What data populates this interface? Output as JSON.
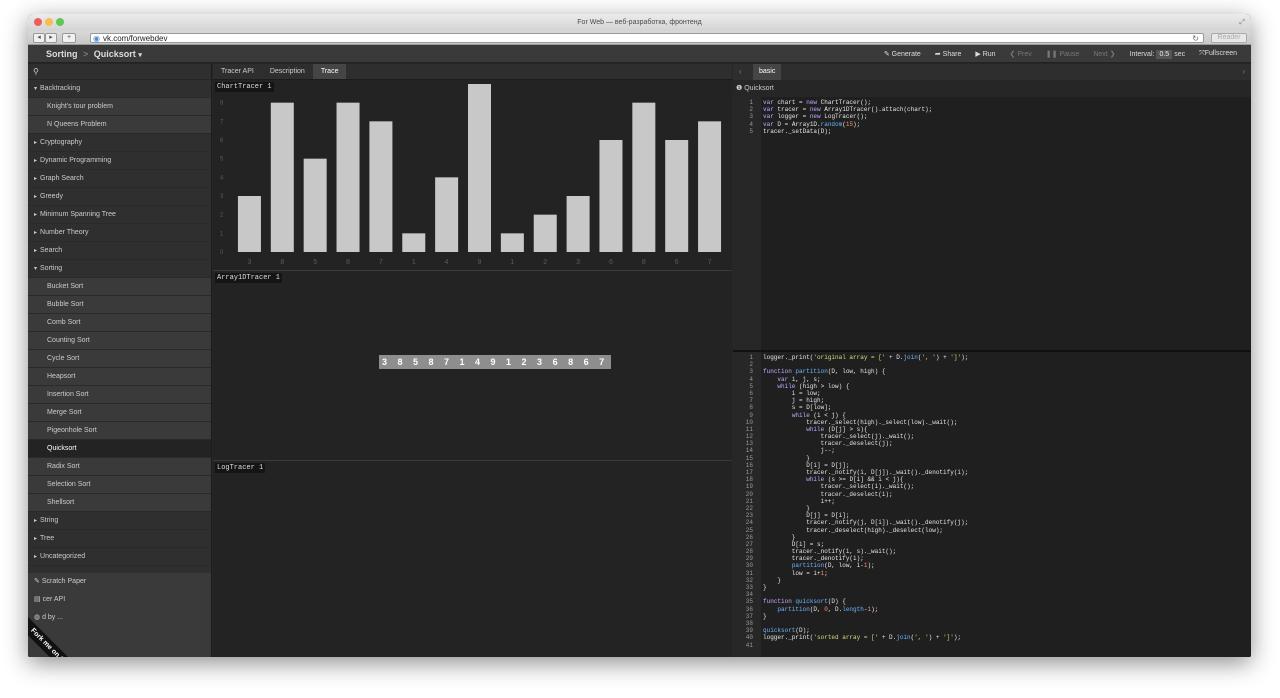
{
  "window": {
    "title": "For Web — веб-разработка, фронтенд",
    "url": "vk.com/forwebdev",
    "reader_label": "Reader"
  },
  "colors": {
    "chart_bar": "#c8c8c8",
    "code_keyword": "#c4a8ff",
    "code_func": "#6fb4ff",
    "code_string": "#dcdc7c",
    "code_number": "#ff8c62"
  },
  "app": {
    "breadcrumb": {
      "category": "Sorting",
      "separator": ">",
      "current": "Quicksort"
    },
    "toolbar": {
      "generate": "Generate",
      "share": "Share",
      "run": "Run",
      "prev": "Prev",
      "pause": "Pause",
      "next": "Next",
      "interval_label": "Interval:",
      "interval_value": "0.5",
      "interval_unit": "sec",
      "fullscreen": "Fullscreen"
    }
  },
  "sidebar": {
    "items": [
      {
        "label": "Backtracking",
        "type": "category",
        "expanded": true
      },
      {
        "label": "Knight's tour problem",
        "type": "algorithm"
      },
      {
        "label": "N Queens Problem",
        "type": "algorithm"
      },
      {
        "label": "Cryptography",
        "type": "category"
      },
      {
        "label": "Dynamic Programming",
        "type": "category"
      },
      {
        "label": "Graph Search",
        "type": "category"
      },
      {
        "label": "Greedy",
        "type": "category"
      },
      {
        "label": "Minimum Spanning Tree",
        "type": "category"
      },
      {
        "label": "Number Theory",
        "type": "category"
      },
      {
        "label": "Search",
        "type": "category"
      },
      {
        "label": "Sorting",
        "type": "category",
        "expanded": true
      },
      {
        "label": "Bucket Sort",
        "type": "algorithm"
      },
      {
        "label": "Bubble Sort",
        "type": "algorithm"
      },
      {
        "label": "Comb Sort",
        "type": "algorithm"
      },
      {
        "label": "Counting Sort",
        "type": "algorithm"
      },
      {
        "label": "Cycle Sort",
        "type": "algorithm"
      },
      {
        "label": "Heapsort",
        "type": "algorithm"
      },
      {
        "label": "Insertion Sort",
        "type": "algorithm"
      },
      {
        "label": "Merge Sort",
        "type": "algorithm"
      },
      {
        "label": "Pigeonhole Sort",
        "type": "algorithm"
      },
      {
        "label": "Quicksort",
        "type": "algorithm",
        "active": true
      },
      {
        "label": "Radix Sort",
        "type": "algorithm"
      },
      {
        "label": "Selection Sort",
        "type": "algorithm"
      },
      {
        "label": "Shellsort",
        "type": "algorithm"
      },
      {
        "label": "String",
        "type": "category"
      },
      {
        "label": "Tree",
        "type": "category"
      },
      {
        "label": "Uncategorized",
        "type": "category"
      }
    ],
    "bottom_links": [
      "Scratch Paper",
      "cer API",
      "d by ..."
    ],
    "ribbon": "Fork me on GitHub"
  },
  "viz": {
    "tabs": [
      "Tracer API",
      "Description",
      "Trace"
    ],
    "active_tab": "Trace",
    "chart_label": "ChartTracer 1",
    "array_label": "Array1DTracer 1",
    "log_label": "LogTracer 1",
    "array_text": "3 8 5 8 7 1 4 9 1 2 3 6 8 6 7"
  },
  "chart_data": {
    "type": "bar",
    "categories": [
      "3",
      "8",
      "5",
      "8",
      "7",
      "1",
      "4",
      "9",
      "1",
      "2",
      "3",
      "6",
      "8",
      "6",
      "7"
    ],
    "values": [
      3,
      8,
      5,
      8,
      7,
      1,
      4,
      9,
      1,
      2,
      3,
      6,
      8,
      6,
      7
    ],
    "yticks": [
      0,
      1,
      2,
      3,
      4,
      5,
      6,
      7,
      8
    ],
    "ylim": [
      0,
      9
    ],
    "grid": false
  },
  "editor": {
    "tab": "basic",
    "file": "Quicksort",
    "data_code": [
      "var chart = new ChartTracer();",
      "var tracer = new Array1DTracer().attach(chart);",
      "var logger = new LogTracer();",
      "var D = Array1D.random(15);",
      "tracer._setData(D);"
    ],
    "algo_code": [
      "logger._print('original array = [' + D.join(', ') + ']');",
      "",
      "function partition(D, low, high) {",
      "    var i, j, s;",
      "    while (high > low) {",
      "        i = low;",
      "        j = high;",
      "        s = D[low];",
      "        while (i < j) {",
      "            tracer._select(high)._select(low)._wait();",
      "            while (D[j] > s){",
      "                tracer._select(j)._wait();",
      "                tracer._deselect(j);",
      "                j--;",
      "            }",
      "            D[i] = D[j];",
      "            tracer._notify(i, D[j])._wait()._denotify(i);",
      "            while (s >= D[i] && i < j){",
      "                tracer._select(i)._wait();",
      "                tracer._deselect(i);",
      "                i++;",
      "            }",
      "            D[j] = D[i];",
      "            tracer._notify(j, D[i])._wait()._denotify(j);",
      "            tracer._deselect(high)._deselect(low);",
      "        }",
      "        D[i] = s;",
      "        tracer._notify(i, s)._wait();",
      "        tracer._denotify(i);",
      "        partition(D, low, i-1);",
      "        low = i+1;",
      "    }",
      "}",
      "",
      "function quicksort(D) {",
      "    partition(D, 0, D.length-1);",
      "}",
      "",
      "quicksort(D);",
      "logger._print('sorted array = [' + D.join(', ') + ']');",
      ""
    ]
  }
}
